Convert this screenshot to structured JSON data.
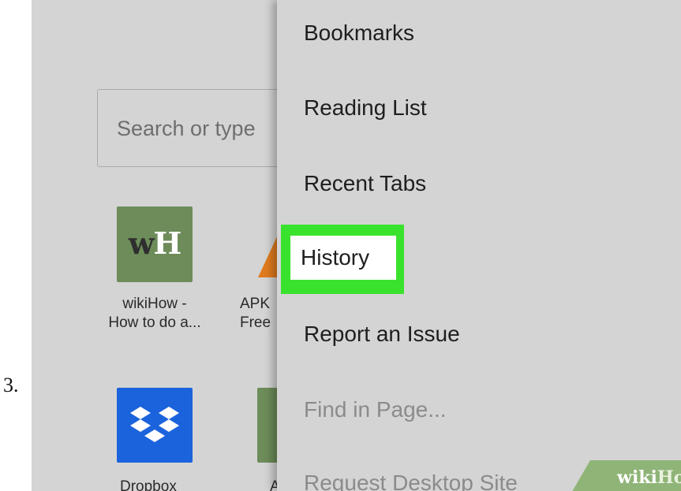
{
  "step": {
    "number": "3."
  },
  "search": {
    "placeholder": "Search or type"
  },
  "shortcuts": [
    {
      "logo_w": "w",
      "logo_h": "H",
      "line1": "wikiHow -",
      "line2": "How to do a..."
    },
    {
      "line1": "APK",
      "line2": "Free"
    },
    {
      "line1": "Dropbox"
    },
    {
      "line1": "A"
    }
  ],
  "menu": {
    "items": [
      {
        "label": "Bookmarks",
        "enabled": true
      },
      {
        "label": "Reading List",
        "enabled": true
      },
      {
        "label": "Recent Tabs",
        "enabled": true
      },
      {
        "label": "History",
        "enabled": true,
        "highlighted": true
      },
      {
        "label": "Report an Issue",
        "enabled": true
      },
      {
        "label": "Find in Page...",
        "enabled": false
      },
      {
        "label": "Request Desktop Site",
        "enabled": false
      }
    ]
  },
  "watermark": {
    "wiki": "wiki",
    "how": "How"
  },
  "colors": {
    "screen_bg": "#d4d4d4",
    "highlight": "#39e22d",
    "wikihow_tile": "#6d8c59",
    "dropbox_tile": "#1b63dc",
    "apk_orange": "#e07b1e"
  }
}
